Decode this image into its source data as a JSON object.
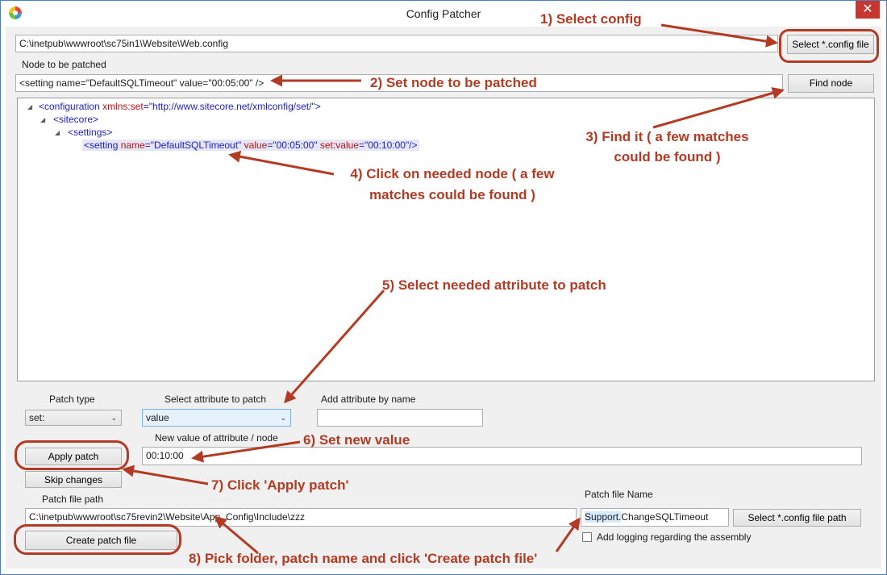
{
  "window": {
    "title": "Config Patcher",
    "close_glyph": "✕"
  },
  "config_path": {
    "value": "C:\\inetpub\\wwwroot\\sc75in1\\Website\\Web.config",
    "button": "Select *.config file"
  },
  "node": {
    "label": "Node to be patched",
    "value": "<setting name=\"DefaultSQLTimeout\" value=\"00:05:00\" />",
    "button": "Find node"
  },
  "tree": {
    "root_open": "<configuration ",
    "root_attr": "xmlns:set",
    "root_eq": "=",
    "root_val": "\"http://www.sitecore.net/xmlconfig/set/\"",
    "root_close": ">",
    "sitecore": "<sitecore>",
    "settings": "<settings>",
    "leaf_tag": "<setting ",
    "leaf_a1": "name",
    "leaf_v1": "=\"DefaultSQLTimeout\"",
    "leaf_a2": " value",
    "leaf_v2": "=\"00:05:00\"",
    "leaf_a3": " set:value",
    "leaf_v3": "=\"00:10:00\"",
    "leaf_end": "/>"
  },
  "patch_type": {
    "label": "Patch type",
    "value": "set:"
  },
  "select_attr": {
    "label": "Select attribute to patch",
    "value": "value"
  },
  "add_attr": {
    "label": "Add attribute by name",
    "value": ""
  },
  "new_value": {
    "label": "New value of attribute / node",
    "value": "00:10:00"
  },
  "buttons": {
    "apply": "Apply patch",
    "skip": "Skip changes",
    "create": "Create patch file",
    "select_path": "Select *.config file path"
  },
  "patch_path": {
    "label": "Patch file path",
    "value": "C:\\inetpub\\wwwroot\\sc75revin2\\Website\\App_Config\\Include\\zzz"
  },
  "patch_name": {
    "label": "Patch file Name",
    "selected": "Support.",
    "rest": "ChangeSQLTimeout"
  },
  "logging": {
    "label": "Add logging regarding the assembly",
    "checked": false
  },
  "annotations": {
    "a1": "1) Select config",
    "a2": "2) Set node to be patched",
    "a3_line1": "3) Find it ( a few matches",
    "a3_line2": "could be found )",
    "a4_line1": "4) Click on needed node ( a few",
    "a4_line2": "matches could be found )",
    "a5": "5) Select needed attribute to patch",
    "a6": "6) Set new value",
    "a7": "7) Click 'Apply patch'",
    "a8": "8) Pick folder, patch name and click 'Create patch file'"
  },
  "colors": {
    "annotation": "#b33b24",
    "close": "#c7372f"
  }
}
